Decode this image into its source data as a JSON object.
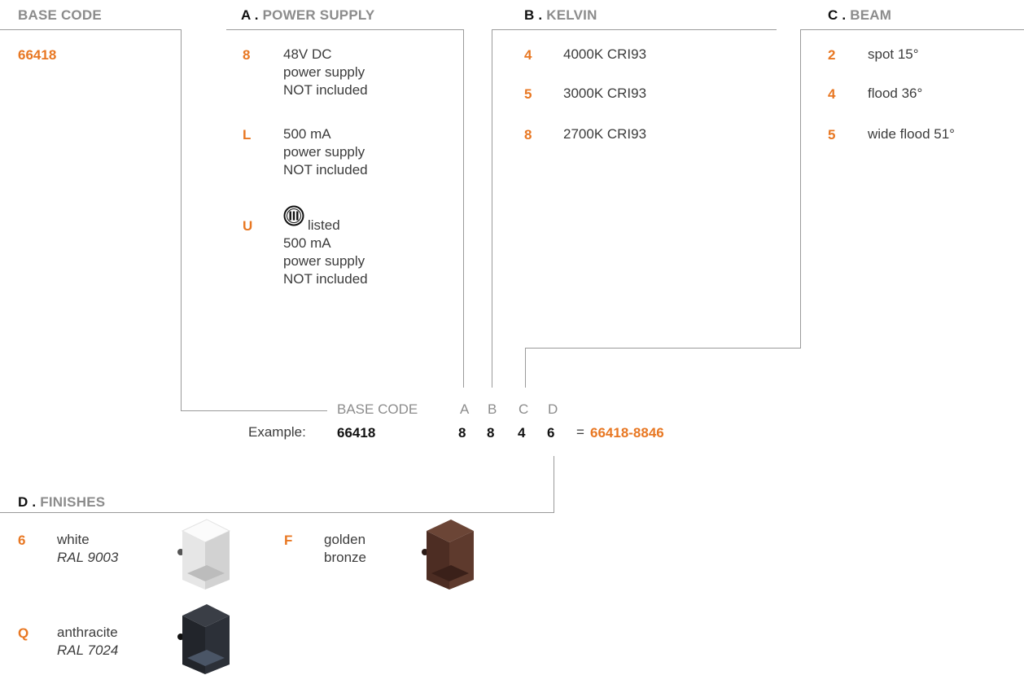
{
  "base_code": {
    "header": "BASE CODE",
    "value": "66418"
  },
  "power_supply": {
    "letter": "A",
    "title": "POWER SUPPLY",
    "options": [
      {
        "code": "8",
        "lines": [
          "48V DC",
          "power supply",
          "NOT included"
        ]
      },
      {
        "code": "L",
        "lines": [
          "500 mA",
          "power supply",
          "NOT included"
        ]
      },
      {
        "code": "U",
        "listed": "listed",
        "lines": [
          "500 mA",
          "power supply",
          "NOT included"
        ]
      }
    ]
  },
  "kelvin": {
    "letter": "B",
    "title": "KELVIN",
    "options": [
      {
        "code": "4",
        "label": "4000K CRI93"
      },
      {
        "code": "5",
        "label": "3000K CRI93"
      },
      {
        "code": "8",
        "label": "2700K CRI93"
      }
    ]
  },
  "beam": {
    "letter": "C",
    "title": "BEAM",
    "options": [
      {
        "code": "2",
        "label": "spot 15°"
      },
      {
        "code": "4",
        "label": "flood 36°"
      },
      {
        "code": "5",
        "label": "wide flood 51°"
      }
    ]
  },
  "example": {
    "label": "Example:",
    "col_labels": {
      "base": "BASE CODE",
      "a": "A",
      "b": "B",
      "c": "C",
      "d": "D"
    },
    "values": {
      "base": "66418",
      "a": "8",
      "b": "8",
      "c": "4",
      "d": "6"
    },
    "equals": "=",
    "result": "66418-8846"
  },
  "finishes": {
    "letter": "D",
    "title": "FINISHES",
    "options": [
      {
        "code": "6",
        "name": "white",
        "ral": "RAL 9003",
        "color": "#e9e9e9"
      },
      {
        "code": "F",
        "name_lines": [
          "golden",
          "bronze"
        ],
        "color": "#5a3326"
      },
      {
        "code": "Q",
        "name": "anthracite",
        "ral": "RAL 7024",
        "color": "#2a2d33"
      }
    ]
  },
  "colors": {
    "accent": "#e87722",
    "header_gray": "#8c8c8c",
    "line": "#9a9a9a"
  }
}
